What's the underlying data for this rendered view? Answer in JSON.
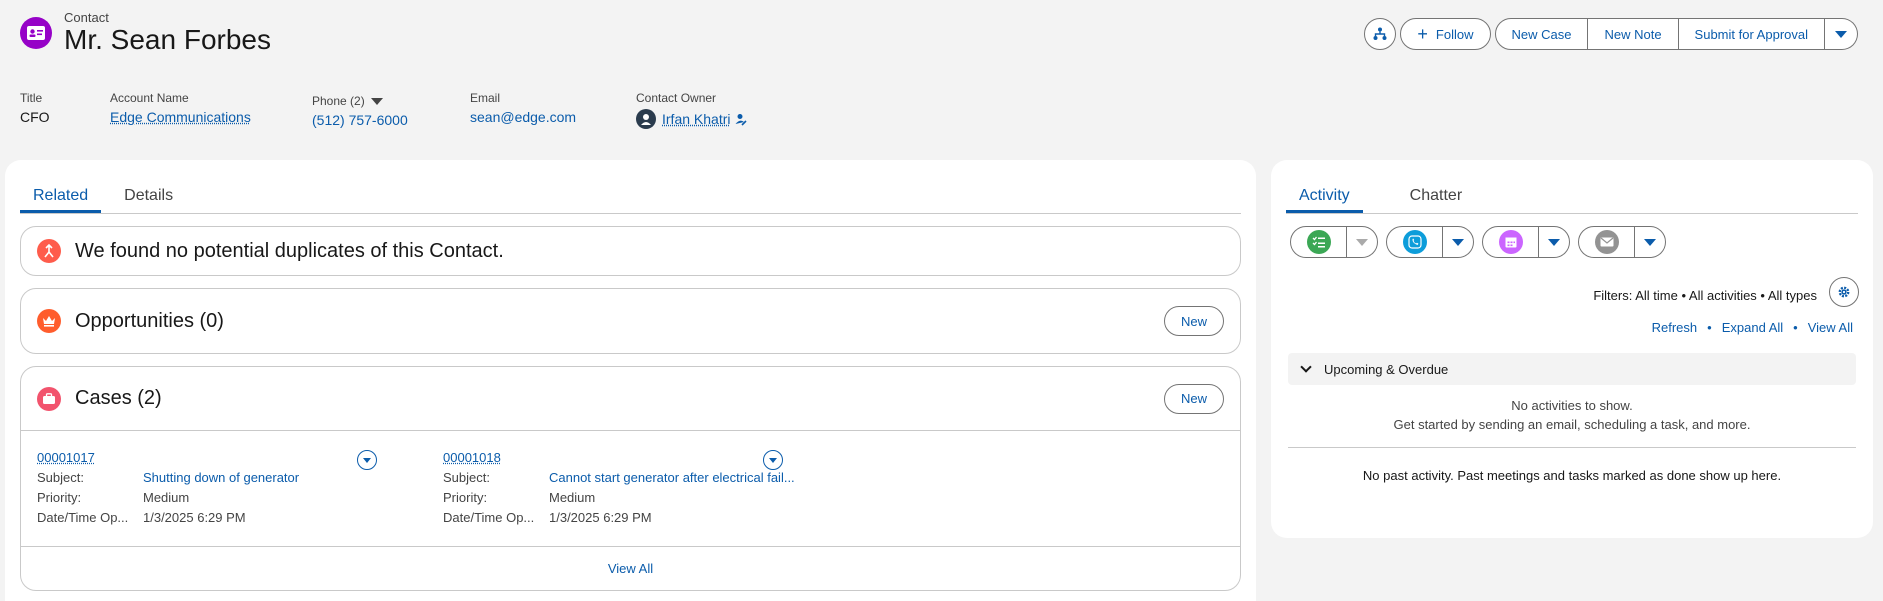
{
  "header": {
    "object_type": "Contact",
    "name": "Mr. Sean Forbes",
    "icon": "contact-card-icon",
    "accent_color": "#9602c7"
  },
  "actions": {
    "hierarchy_icon": "hierarchy-icon",
    "follow_label": "Follow",
    "new_case_label": "New Case",
    "new_note_label": "New Note",
    "submit_label": "Submit for Approval"
  },
  "fields": {
    "title_label": "Title",
    "title_value": "CFO",
    "account_label": "Account Name",
    "account_value": "Edge Communications",
    "phone_label": "Phone (2)",
    "phone_value": "(512) 757-6000",
    "email_label": "Email",
    "email_value": "sean@edge.com",
    "owner_label": "Contact Owner",
    "owner_value": "Irfan Khatri"
  },
  "left_tabs": [
    "Related",
    "Details"
  ],
  "duplicates": {
    "message": "We found no potential duplicates of this Contact.",
    "icon": "duplicate-icon",
    "color": "#fe5c4c"
  },
  "opportunities": {
    "title": "Opportunities (0)",
    "new_label": "New",
    "icon": "crown-icon",
    "color": "#ff5d2d"
  },
  "cases": {
    "title": "Cases (2)",
    "new_label": "New",
    "icon": "briefcase-icon",
    "color": "#f2536d",
    "view_all": "View All",
    "labels": {
      "subject": "Subject:",
      "priority": "Priority:",
      "datetime": "Date/Time Op..."
    },
    "items": [
      {
        "number": "00001017",
        "subject": "Shutting down of generator",
        "priority": "Medium",
        "datetime": "1/3/2025 6:29 PM"
      },
      {
        "number": "00001018",
        "subject": "Cannot start generator after electrical fail...",
        "priority": "Medium",
        "datetime": "1/3/2025 6:29 PM"
      }
    ]
  },
  "right_tabs": [
    "Activity",
    "Chatter"
  ],
  "activity": {
    "buttons": [
      {
        "icon": "task-icon",
        "color": "#3ba755"
      },
      {
        "icon": "phone-call-icon",
        "color": "#0d9dda"
      },
      {
        "icon": "calendar-icon",
        "color": "#cb65ff"
      },
      {
        "icon": "email-icon",
        "color": "#939393"
      }
    ],
    "filters": "Filters: All time • All activities • All types",
    "refresh": "Refresh",
    "expand_all": "Expand All",
    "view_all": "View All",
    "upcoming_label": "Upcoming & Overdue",
    "no_activities": "No activities to show.",
    "get_started": "Get started by sending an email, scheduling a task, and more.",
    "no_past": "No past activity. Past meetings and tasks marked as done show up here."
  }
}
